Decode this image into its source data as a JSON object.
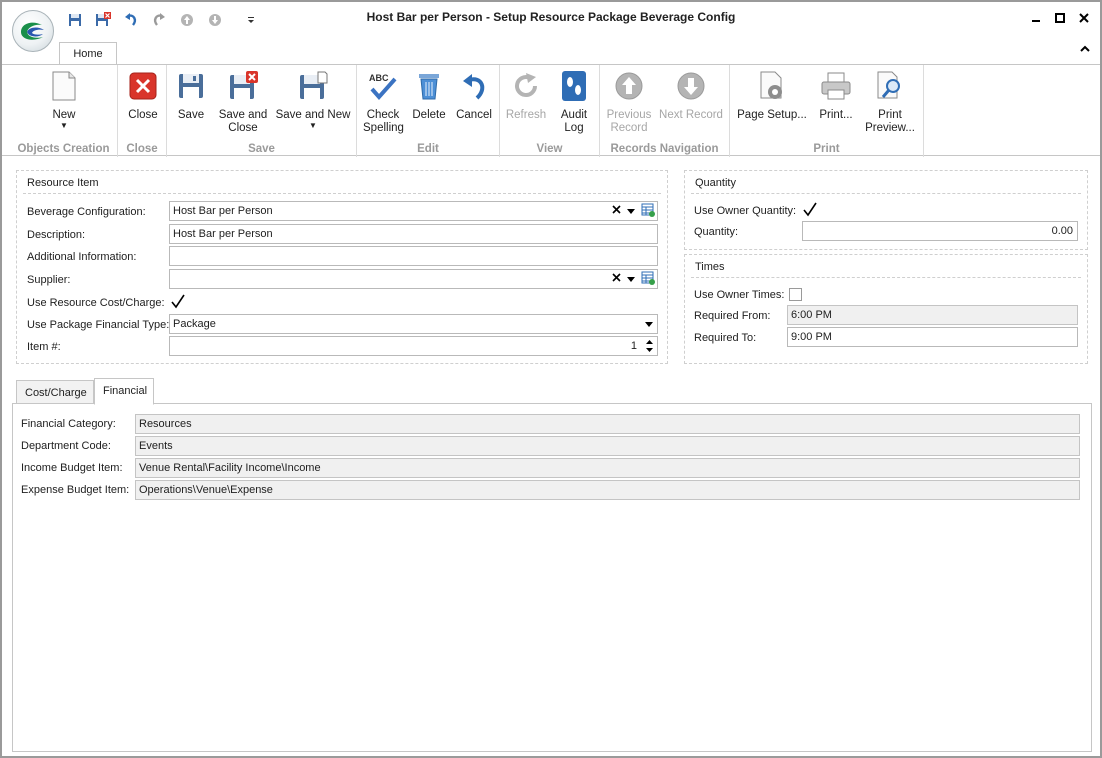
{
  "window": {
    "title": "Host Bar per Person - Setup Resource Package Beverage Config"
  },
  "icons": {
    "app_orb": "app-logo-icon",
    "quick_access": [
      "save-icon",
      "save-close-icon",
      "undo-icon",
      "redo-icon",
      "up-icon",
      "down-icon",
      "customize-icon"
    ],
    "window_controls": [
      "minimize-icon",
      "maximize-icon",
      "close-icon"
    ]
  },
  "ribbon": {
    "tab": "Home",
    "groups": [
      {
        "label": "Objects Creation",
        "buttons": [
          {
            "label": "New",
            "icon": "new-document-icon"
          }
        ]
      },
      {
        "label": "Close",
        "buttons": [
          {
            "label": "Close",
            "icon": "close-red-icon"
          }
        ]
      },
      {
        "label": "Save",
        "buttons": [
          {
            "label": "Save",
            "icon": "floppy-save-icon"
          },
          {
            "label": "Save and Close",
            "icon": "floppy-save-close-icon"
          },
          {
            "label": "Save and New",
            "icon": "floppy-save-new-icon"
          }
        ]
      },
      {
        "label": "Edit",
        "buttons": [
          {
            "label": "Check Spelling",
            "icon": "spellcheck-icon"
          },
          {
            "label": "Delete",
            "icon": "trash-icon"
          },
          {
            "label": "Cancel",
            "icon": "undo-arrow-icon"
          }
        ]
      },
      {
        "label": "View",
        "buttons": [
          {
            "label": "Refresh",
            "icon": "refresh-icon",
            "disabled": true
          },
          {
            "label": "Audit Log",
            "icon": "footprints-icon"
          }
        ]
      },
      {
        "label": "Records Navigation",
        "buttons": [
          {
            "label": "Previous Record",
            "icon": "arrow-up-circle-icon",
            "disabled": true
          },
          {
            "label": "Next Record",
            "icon": "arrow-down-circle-icon",
            "disabled": true
          }
        ]
      },
      {
        "label": "Print",
        "buttons": [
          {
            "label": "Page Setup...",
            "icon": "page-setup-icon"
          },
          {
            "label": "Print...",
            "icon": "printer-icon"
          },
          {
            "label": "Print Preview...",
            "icon": "print-preview-icon"
          }
        ]
      }
    ]
  },
  "resource_item": {
    "title": "Resource Item",
    "beverage_configuration": {
      "label": "Beverage Configuration:",
      "value": "Host Bar per Person"
    },
    "description": {
      "label": "Description:",
      "value": "Host Bar per Person"
    },
    "additional_information": {
      "label": "Additional Information:",
      "value": ""
    },
    "supplier": {
      "label": "Supplier:",
      "value": ""
    },
    "use_resource_cost": {
      "label": "Use Resource Cost/Charge:",
      "checked": true
    },
    "financial_type": {
      "label": "Use Package Financial Type:",
      "value": "Package"
    },
    "item_number": {
      "label": "Item #:",
      "value": "1"
    }
  },
  "quantity": {
    "title": "Quantity",
    "use_owner_quantity": {
      "label": "Use Owner Quantity:",
      "checked": true
    },
    "quantity": {
      "label": "Quantity:",
      "value": "0.00"
    }
  },
  "times": {
    "title": "Times",
    "use_owner_times": {
      "label": "Use Owner Times:",
      "checked": false
    },
    "required_from": {
      "label": "Required From:",
      "value": "6:00 PM"
    },
    "required_to": {
      "label": "Required To:",
      "value": "9:00 PM"
    }
  },
  "detail_tabs": [
    "Cost/Charge",
    "Financial"
  ],
  "financial": {
    "financial_category": {
      "label": "Financial Category:",
      "value": "Resources"
    },
    "department_code": {
      "label": "Department Code:",
      "value": "Events"
    },
    "income_budget_item": {
      "label": "Income Budget Item:",
      "value": "Venue Rental\\Facility Income\\Income"
    },
    "expense_budget_item": {
      "label": "Expense Budget Item:",
      "value": "Operations\\Venue\\Expense"
    }
  },
  "colors": {
    "accent_blue": "#2f6db5",
    "close_red": "#d9352b",
    "disabled_gray": "#a6a6a6"
  }
}
